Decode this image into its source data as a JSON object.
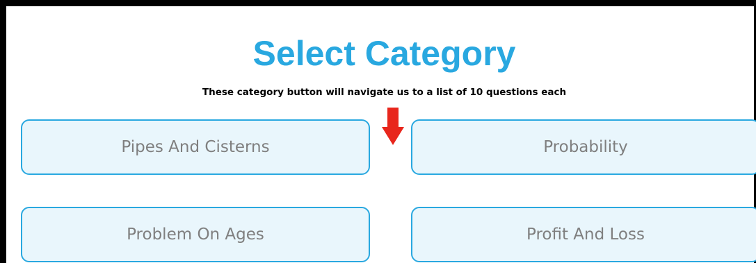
{
  "page": {
    "title": "Select Category",
    "subtitle": "These category button will navigate us to a list of 10 questions each"
  },
  "categories": [
    {
      "label": "Pipes And Cisterns"
    },
    {
      "label": "Probability"
    },
    {
      "label": "Problem On Ages"
    },
    {
      "label": "Profit And Loss"
    }
  ],
  "annotation": {
    "icon": "arrow-down-icon",
    "color": "#e8261c"
  },
  "colors": {
    "accent": "#29a8e0",
    "button_fill": "#e9f6fc",
    "button_text": "#7f7f7f"
  }
}
